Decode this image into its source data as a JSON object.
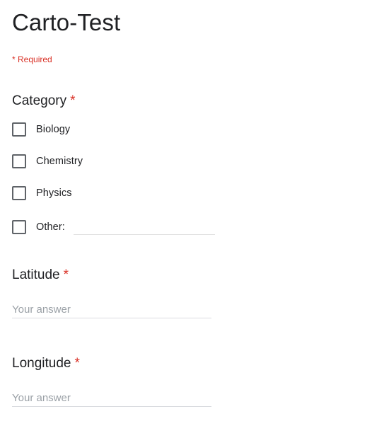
{
  "form": {
    "title": "Carto-Test",
    "required_note": "* Required"
  },
  "questions": {
    "category": {
      "title": "Category",
      "required_mark": "*",
      "options": [
        {
          "label": "Biology",
          "checked": false
        },
        {
          "label": "Chemistry",
          "checked": false
        },
        {
          "label": "Physics",
          "checked": false
        },
        {
          "label": "Other:",
          "checked": false,
          "other_value": ""
        }
      ]
    },
    "latitude": {
      "title": "Latitude",
      "required_mark": "*",
      "placeholder": "Your answer",
      "value": ""
    },
    "longitude": {
      "title": "Longitude",
      "required_mark": "*",
      "placeholder": "Your answer",
      "value": ""
    }
  },
  "colors": {
    "required_red": "#d93025",
    "text": "#202124",
    "checkbox_border": "#5f6368",
    "placeholder": "#9aa0a6",
    "underline": "#dadce0"
  }
}
